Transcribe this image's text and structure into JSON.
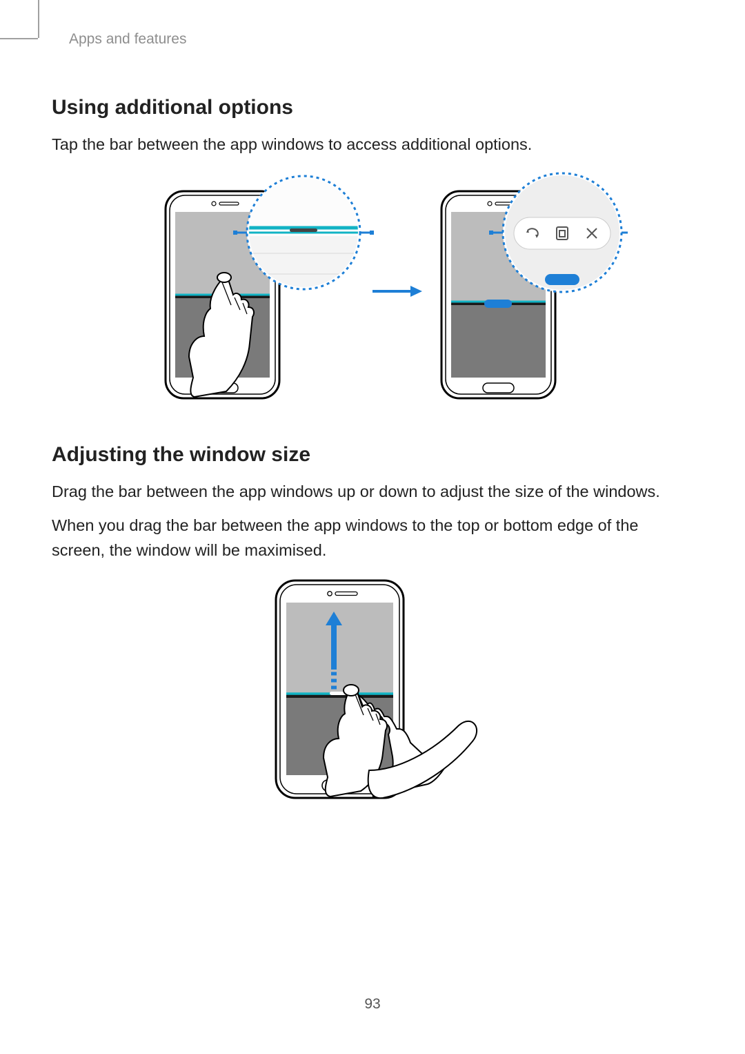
{
  "breadcrumb": "Apps and features",
  "section1": {
    "heading": "Using additional options",
    "body": "Tap the bar between the app windows to access additional options."
  },
  "section2": {
    "heading": "Adjusting the window size",
    "body1": "Drag the bar between the app windows up or down to adjust the size of the windows.",
    "body2": "When you drag the bar between the app windows to the top or bottom edge of the screen, the window will be maximised."
  },
  "page_number": "93"
}
